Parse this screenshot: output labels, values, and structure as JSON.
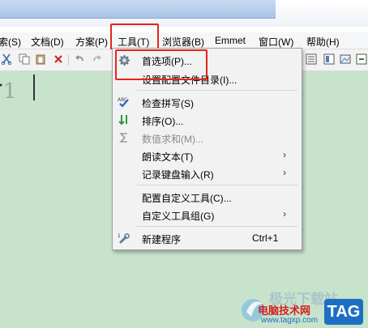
{
  "menubar": {
    "items": [
      "索(S)",
      "文档(D)",
      "方案(P)",
      "工具(T)",
      "浏览器(B)",
      "Emmet",
      "窗口(W)",
      "帮助(H)"
    ]
  },
  "editor": {
    "line_number": "1"
  },
  "tools_menu": {
    "items": [
      {
        "label": "首选项(P)...",
        "icon": "gear-icon"
      },
      {
        "label": "设置配置文件目录(I)..."
      },
      {
        "label": "检查拼写(S)",
        "icon": "spellcheck-icon"
      },
      {
        "label": "排序(O)...",
        "icon": "sort-icon"
      },
      {
        "label": "数值求和(M)...",
        "icon": "sigma-icon",
        "disabled": true
      },
      {
        "label": "朗读文本(T)",
        "submenu": true
      },
      {
        "label": "记录键盘输入(R)",
        "submenu": true
      },
      {
        "label": "配置自定义工具(C)..."
      },
      {
        "label": "自定义工具组(G)",
        "submenu": true
      },
      {
        "label": "新建程序",
        "icon": "wrench-icon",
        "shortcut": "Ctrl+1"
      }
    ],
    "submenu_arrow": "›"
  },
  "watermark": {
    "site_name": "极光下载站",
    "line1": "电脑技术网",
    "url": "www.tagxp.com",
    "tag": "TAG"
  },
  "colors": {
    "highlight": "#e5261c",
    "editor_bg": "#c7e3cb",
    "tag_blue": "#1d6fc4"
  }
}
